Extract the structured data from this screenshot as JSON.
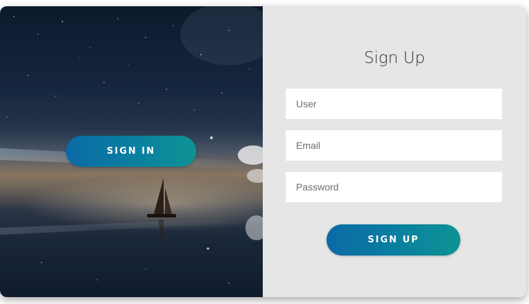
{
  "left_panel": {
    "sign_in_label": "SIGN IN"
  },
  "form": {
    "title": "Sign Up",
    "user_placeholder": "User",
    "email_placeholder": "Email",
    "password_placeholder": "Password",
    "sign_up_label": "SIGN UP"
  },
  "colors": {
    "button_gradient_start": "#0b6aa6",
    "button_gradient_end": "#0d9394",
    "form_background": "#e6e6e6",
    "input_background": "#ffffff"
  },
  "icons": {
    "background_image": "night-sea-sailboat"
  }
}
